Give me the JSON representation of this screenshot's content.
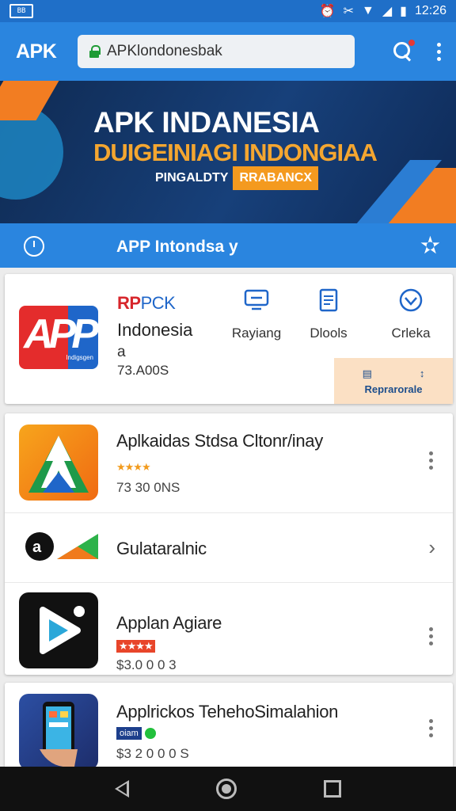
{
  "status": {
    "time": "12:26",
    "left_icon": "BB"
  },
  "appbar": {
    "brand": "APK",
    "url": "APKlondonesbak"
  },
  "banner": {
    "title": "APK INDANESIA",
    "subtitle": "DUIGEINIAGI INDONGIAA",
    "tag_left": "PINGALDTY",
    "tag_right": "RRABANCX"
  },
  "navstrip": {
    "title": "APP Intondsa y"
  },
  "featured": {
    "logo_text": "APP",
    "logo_small": "Indigsgen",
    "name_line1_red": "RP",
    "name_line1_blue": "PCK",
    "name_line2": "Indonesia",
    "name_line3": "a",
    "size": "73.A00S",
    "actions": [
      {
        "label": "Rayiang",
        "icon": "monitor-icon"
      },
      {
        "label": "Dlools",
        "icon": "document-icon"
      },
      {
        "label": "Crleka",
        "icon": "heart-shield-icon"
      }
    ],
    "repo_label": "Reprarorale"
  },
  "apps": [
    {
      "title": "Aplkaidas Stdsa Cltonr/inay",
      "size": "73 30 0NS",
      "rating_color": "#f29b1d"
    },
    {
      "title": "Gulataralnic"
    },
    {
      "title": "Applan Agiare",
      "size": "$3.0 0 0 3",
      "rating_color": "#e8452a"
    },
    {
      "title": "Applrickos TehehoSimalahion",
      "size": "$3 2 0 0 0 S",
      "badge": "oiam"
    }
  ],
  "colors": {
    "primary": "#2a85df",
    "accent": "#f49a1f",
    "status": "#1f6fc8"
  }
}
